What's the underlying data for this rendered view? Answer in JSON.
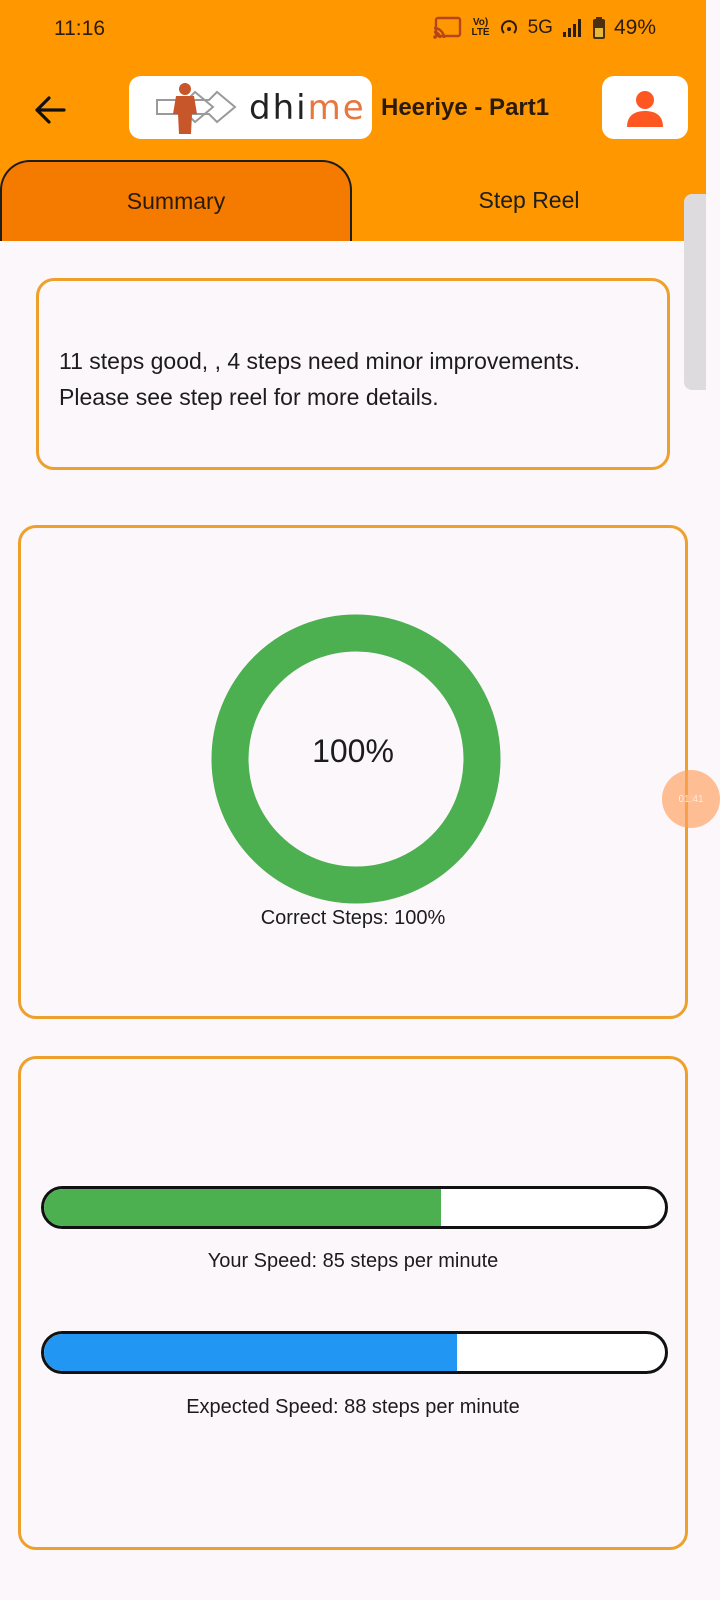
{
  "status_bar": {
    "time": "11:16",
    "network": "5G",
    "battery": "49%"
  },
  "app_bar": {
    "logo": {
      "text_dark": "dhi",
      "text_accent": "me",
      "accent_color": "#e8763f"
    },
    "title": "Heeriye - Part1"
  },
  "tabs": [
    {
      "label": "Summary",
      "active": true
    },
    {
      "label": "Step Reel",
      "active": false
    }
  ],
  "summary": {
    "line1": "11 steps good, , 4 steps need minor improvements.",
    "line2": "Please see step reel for more details."
  },
  "correct_steps": {
    "percent": 100,
    "center_label": "100%",
    "caption": "Correct Steps: 100%",
    "ring_color": "#4caf50"
  },
  "speed": {
    "your": {
      "fraction": 0.64,
      "caption": "Your Speed: 85 steps per minute",
      "color": "#4caf50"
    },
    "expected": {
      "fraction": 0.665,
      "caption": "Expected Speed: 88 steps per minute",
      "color": "#2196f3"
    }
  },
  "floating_bubble": {
    "label": "01:41"
  }
}
